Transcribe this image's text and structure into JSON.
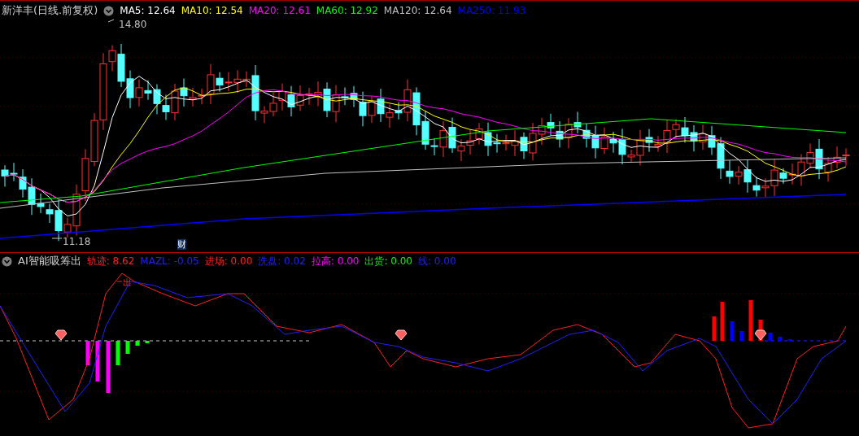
{
  "title": "新洋丰(日线.前复权)",
  "indicators": [
    {
      "label": "MA5: 12.64",
      "color": "#ffffff"
    },
    {
      "label": "MA10: 12.54",
      "color": "#ffff00"
    },
    {
      "label": "MA20: 12.61",
      "color": "#ff00ff"
    },
    {
      "label": "MA60: 12.92",
      "color": "#00ff00"
    },
    {
      "label": "MA120: 12.64",
      "color": "#c0c0c0"
    },
    {
      "label": "MA250: 11.93",
      "color": "#0000ff"
    }
  ],
  "price_labels": {
    "high": "14.80",
    "low": "11.18"
  },
  "event_marker": "财",
  "sub_panel": {
    "title": "AI智能吸筹出",
    "marker": "出",
    "indicators": [
      {
        "label": "轨迹: 8.62",
        "color": "#ff2020"
      },
      {
        "label": "MAZL: -0.05",
        "color": "#2020ff"
      },
      {
        "label": "进场: 0.00",
        "color": "#ff2020"
      },
      {
        "label": "洗盘: 0.02",
        "color": "#2020ff"
      },
      {
        "label": "拉高: 0.00",
        "color": "#ff00ff"
      },
      {
        "label": "出货: 0.00",
        "color": "#00ff00"
      },
      {
        "label": "线: 0.00",
        "color": "#2020ff"
      }
    ]
  }
}
